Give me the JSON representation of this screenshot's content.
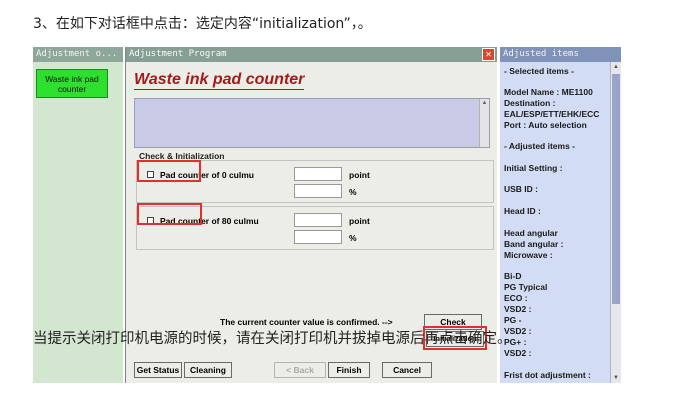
{
  "instructions": {
    "top": "3、在如下对话框中点击：选定内容“initialization”，。",
    "overlay": "当提示关闭打印机电源的时候，请在关闭打印机并拔掉电源后再点击确定。"
  },
  "left_panel": {
    "title": "Adjustment o...",
    "item": "Waste ink pad counter"
  },
  "dialog": {
    "title": "Adjustment Program",
    "close": "✕",
    "heading": "Waste ink pad counter",
    "group_title": "Check & Initialization",
    "rows": [
      {
        "label": "Pad counter of  0 culmu",
        "unit_point": "point",
        "unit_percent": "%"
      },
      {
        "label": "Pad counter of 80 culmu",
        "unit_point": "point",
        "unit_percent": "%"
      }
    ],
    "confirm_text": "The current counter value is confirmed. -->",
    "buttons": {
      "check": "Check",
      "initialization": "Initialization",
      "get_status": "Get Status",
      "cleaning": "Cleaning",
      "back": "< Back",
      "finish": "Finish",
      "cancel": "Cancel"
    }
  },
  "right_panel": {
    "title": "Adjusted items",
    "selected_items": "- Selected items -",
    "model_name": "Model Name : ME1100",
    "destination": "Destination :",
    "destination_value": "EAL/ESP/ETT/EHK/ECC",
    "port": "Port : Auto selection",
    "adjusted_items": "- Adjusted items -",
    "initial_setting": "Initial Setting :",
    "usb_id": "USB ID :",
    "head_id": "Head ID :",
    "head_angular": "Head angular",
    "band_angular": " Band angular :",
    "microwave": " Microwave :",
    "bid": "Bi-D",
    "pg_typical": "PG Typical",
    "eco": " ECO   :",
    "vsd2_a": " VSD2 :",
    "pg_minus": "PG -",
    "vsd2_b": " VSD2 :",
    "pg_plus": "PG+ :",
    "vsd2_c": " VSD2 :",
    "first_dot": "Frist dot adjustment :"
  },
  "colors": {
    "accent_red": "#e23030",
    "heading_red": "#a11c1c",
    "green_button": "#2ee02e"
  }
}
